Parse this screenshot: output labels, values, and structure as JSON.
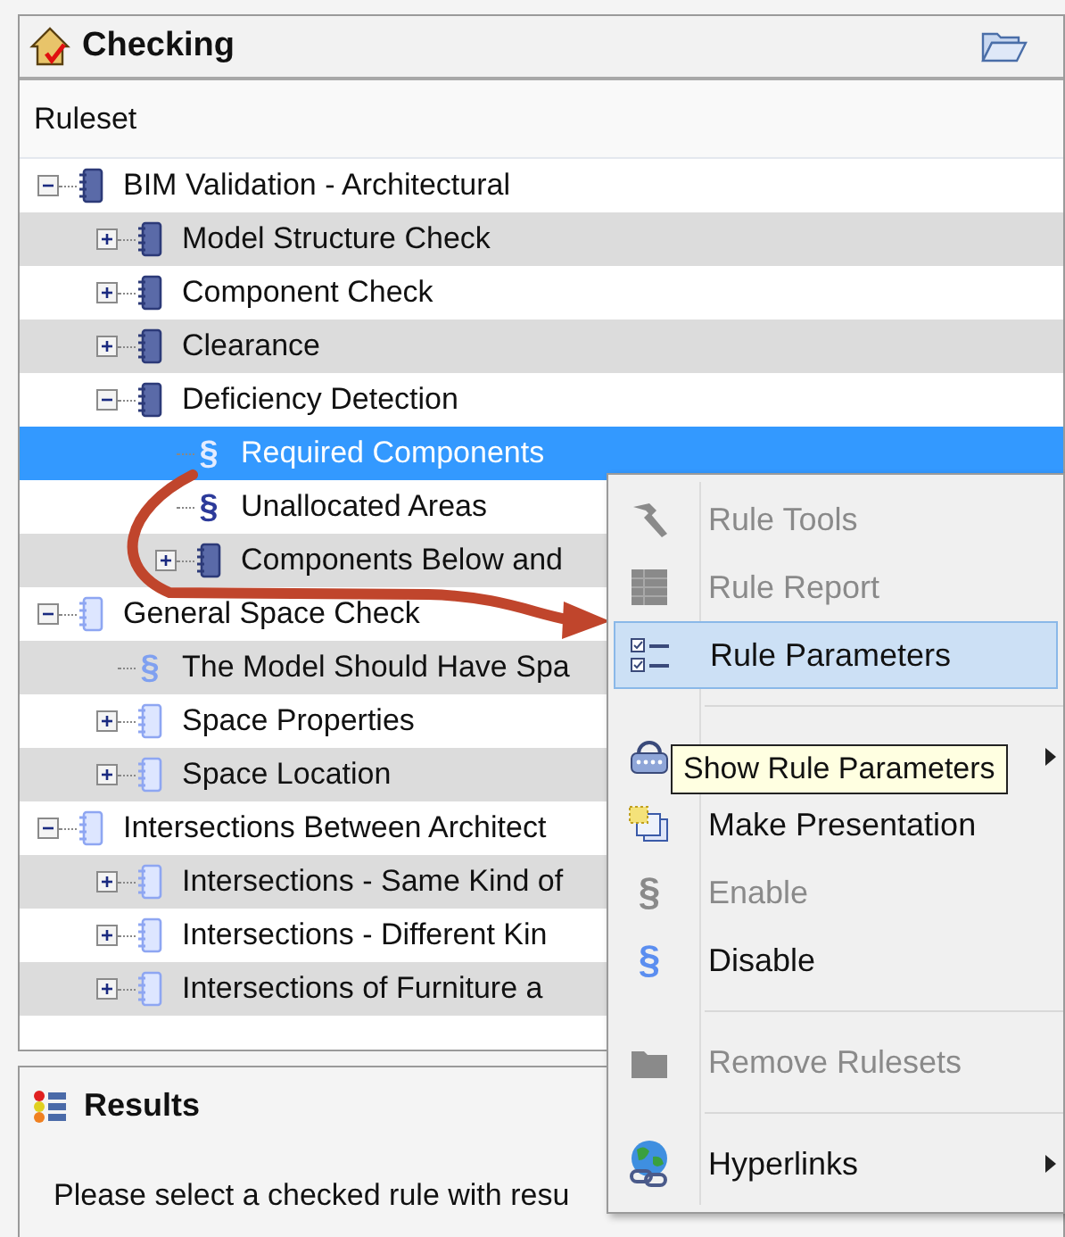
{
  "panel": {
    "title": "Checking"
  },
  "tree": {
    "header": "Ruleset",
    "items": [
      {
        "kind": "ruleset",
        "label": "BIM Validation - Architectural",
        "expanded": true,
        "active": true,
        "selected": false,
        "children": [
          {
            "kind": "ruleset",
            "label": "Model Structure Check",
            "expanded": false,
            "active": true,
            "selected": false
          },
          {
            "kind": "ruleset",
            "label": "Component Check",
            "expanded": false,
            "active": true,
            "selected": false
          },
          {
            "kind": "ruleset",
            "label": "Clearance",
            "expanded": false,
            "active": true,
            "selected": false
          },
          {
            "kind": "ruleset",
            "label": "Deficiency Detection",
            "expanded": true,
            "active": true,
            "selected": false,
            "children": [
              {
                "kind": "rule",
                "glyph": "§",
                "label": "Required Components",
                "active": false,
                "selected": true
              },
              {
                "kind": "rule",
                "glyph": "§",
                "label": "Unallocated Areas",
                "active": true,
                "selected": false
              },
              {
                "kind": "ruleset",
                "label": "Components Below and",
                "expanded": false,
                "active": true,
                "selected": false
              }
            ]
          }
        ]
      },
      {
        "kind": "ruleset",
        "label": "General Space Check",
        "expanded": true,
        "active": false,
        "selected": false,
        "children": [
          {
            "kind": "rule",
            "glyph": "§",
            "label": "The Model Should Have Spa",
            "active": false,
            "selected": false
          },
          {
            "kind": "ruleset",
            "label": "Space Properties",
            "expanded": false,
            "active": false,
            "selected": false
          },
          {
            "kind": "ruleset",
            "label": "Space Location",
            "expanded": false,
            "active": false,
            "selected": false
          }
        ]
      },
      {
        "kind": "ruleset",
        "label": "Intersections Between Architect",
        "expanded": true,
        "active": false,
        "selected": false,
        "children": [
          {
            "kind": "ruleset",
            "label": "Intersections - Same Kind of",
            "expanded": false,
            "active": false,
            "selected": false
          },
          {
            "kind": "ruleset",
            "label": "Intersections - Different Kin",
            "expanded": false,
            "active": false,
            "selected": false
          },
          {
            "kind": "ruleset",
            "label": "Intersections of Furniture a",
            "expanded": false,
            "active": false,
            "selected": false
          }
        ]
      }
    ]
  },
  "results": {
    "title": "Results",
    "message": "Please select a checked rule with resu"
  },
  "context_menu": {
    "items": [
      {
        "kind": "item",
        "label": "Rule Tools",
        "disabled": true,
        "highlighted": false,
        "submenu": false
      },
      {
        "kind": "item",
        "label": "Rule Report",
        "disabled": true,
        "highlighted": false,
        "submenu": false
      },
      {
        "kind": "item",
        "label": "Rule Parameters",
        "disabled": false,
        "highlighted": true,
        "submenu": false
      },
      {
        "kind": "separator"
      },
      {
        "kind": "item",
        "disabled": false,
        "highlighted": false,
        "submenu": true
      },
      {
        "kind": "item",
        "label": "Make Presentation",
        "disabled": false,
        "highlighted": false,
        "submenu": false
      },
      {
        "kind": "item",
        "glyph": "§",
        "label": "Enable",
        "disabled": true,
        "highlighted": false,
        "submenu": false
      },
      {
        "kind": "item",
        "glyph": "§",
        "label": "Disable",
        "disabled": false,
        "highlighted": false,
        "submenu": false
      },
      {
        "kind": "separator"
      },
      {
        "kind": "item",
        "label": "Remove Rulesets",
        "disabled": true,
        "highlighted": false,
        "submenu": false
      },
      {
        "kind": "separator"
      },
      {
        "kind": "item",
        "label": "Hyperlinks",
        "disabled": false,
        "highlighted": false,
        "submenu": true
      }
    ]
  },
  "tooltip": {
    "text": "Show Rule Parameters"
  }
}
